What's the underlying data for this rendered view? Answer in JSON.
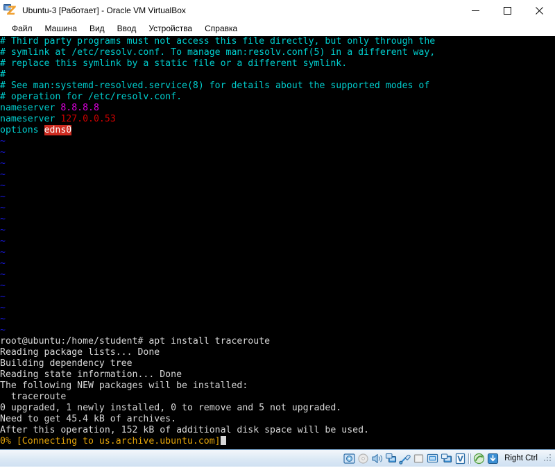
{
  "window": {
    "title": "Ubuntu-3 [Работает] - Oracle VM VirtualBox",
    "icon": "virtualbox-icon",
    "controls": {
      "minimize": "minimize-button",
      "maximize": "maximize-button",
      "close": "close-button"
    }
  },
  "menubar": {
    "items": [
      {
        "label": "Файл",
        "name": "menu-file"
      },
      {
        "label": "Машина",
        "name": "menu-machine"
      },
      {
        "label": "Вид",
        "name": "menu-view"
      },
      {
        "label": "Ввод",
        "name": "menu-input"
      },
      {
        "label": "Устройства",
        "name": "menu-devices"
      },
      {
        "label": "Справка",
        "name": "menu-help"
      }
    ]
  },
  "terminal": {
    "background": "#000000",
    "colors": {
      "cyan": "#00cdcd",
      "white": "#d8d8d8",
      "blue": "#1818d8",
      "magenta": "#e000e0",
      "red": "#cd0000",
      "yellow": "#e5a50a",
      "highlight_bg": "#cd2b20"
    },
    "editor_lines": [
      "# Third party programs must not access this file directly, but only through the",
      "# symlink at /etc/resolv.conf. To manage man:resolv.conf(5) in a different way,",
      "# replace this symlink by a static file or a different symlink.",
      "#",
      "# See man:systemd-resolved.service(8) for details about the supported modes of",
      "# operation for /etc/resolv.conf."
    ],
    "nameserver_rows": [
      {
        "key": "nameserver",
        "value": "8.8.8.8",
        "value_color": "magenta"
      },
      {
        "key": "nameserver",
        "value": "127.0.0.53",
        "value_color": "red"
      }
    ],
    "options_row": {
      "key": "options",
      "value": "edns0"
    },
    "empty_marker": "~",
    "empty_marker_count": 18,
    "shell_lines": [
      "root@ubuntu:/home/student# apt install traceroute",
      "Reading package lists... Done",
      "Building dependency tree",
      "Reading state information... Done",
      "The following NEW packages will be installed:",
      "  traceroute",
      "0 upgraded, 1 newly installed, 0 to remove and 5 not upgraded.",
      "Need to get 45.4 kB of archives.",
      "After this operation, 152 kB of additional disk space will be used."
    ],
    "progress_line": "0% [Connecting to us.archive.ubuntu.com]"
  },
  "statusbar": {
    "icons": [
      {
        "name": "hard-disk-icon"
      },
      {
        "name": "optical-disk-icon"
      },
      {
        "name": "audio-icon"
      },
      {
        "name": "network-icon"
      },
      {
        "name": "usb-icon"
      },
      {
        "name": "shared-folders-icon"
      },
      {
        "name": "display-icon"
      },
      {
        "name": "remote-display-icon"
      },
      {
        "name": "video-capture-icon"
      },
      {
        "name": "separator"
      },
      {
        "name": "guest-additions-icon"
      },
      {
        "name": "host-key-icon"
      }
    ],
    "host_key_label": "Right Ctrl",
    "resize_grip": "resize-grip"
  }
}
